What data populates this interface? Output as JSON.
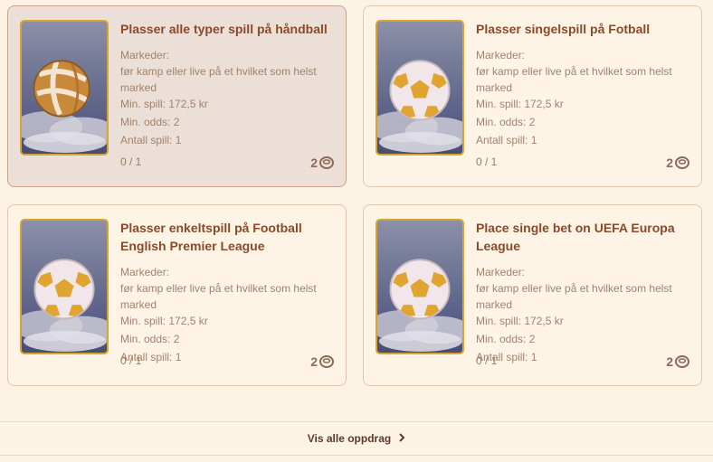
{
  "missions": [
    {
      "title": "Plasser alle typer spill på håndball",
      "markets_label": "Markeder:",
      "markets_value": "før kamp eller live på et hvilket som helst marked",
      "min_stake": "Min. spill: 172,5 kr",
      "min_odds": "Min. odds: 2",
      "bet_count": "Antall spill: 1",
      "progress": "0 / 1",
      "reward": "2",
      "icon": "handball-icon",
      "highlighted": true
    },
    {
      "title": "Plasser singelspill på Fotball",
      "markets_label": "Markeder:",
      "markets_value": "før kamp eller live på et hvilket som helst marked",
      "min_stake": "Min. spill: 172,5 kr",
      "min_odds": "Min. odds: 2",
      "bet_count": "Antall spill: 1",
      "progress": "0 / 1",
      "reward": "2",
      "icon": "football-icon",
      "highlighted": false
    },
    {
      "title": "Plasser enkeltspill på Football English Premier League",
      "markets_label": "Markeder:",
      "markets_value": "før kamp eller live på et hvilket som helst marked",
      "min_stake": "Min. spill: 172,5 kr",
      "min_odds": "Min. odds: 2",
      "bet_count": "Antall spill: 1",
      "progress": "0 / 1",
      "reward": "2",
      "icon": "football-icon",
      "highlighted": false
    },
    {
      "title": "Place single bet on UEFA Europa League",
      "markets_label": "Markeder:",
      "markets_value": "før kamp eller live på et hvilket som helst marked",
      "min_stake": "Min. spill: 172,5 kr",
      "min_odds": "Min. odds: 2",
      "bet_count": "Antall spill: 1",
      "progress": "0 / 1",
      "reward": "2",
      "icon": "football-icon",
      "highlighted": false
    }
  ],
  "footer": {
    "view_all_label": "Vis alle oppdrag",
    "chevron_icon": "chevron-right-icon"
  },
  "colors": {
    "title": "#8a4a2a",
    "text": "#a0826c",
    "border": "#e2c7ae",
    "gold": "#d8a42b",
    "background": "#fdf3e4"
  }
}
